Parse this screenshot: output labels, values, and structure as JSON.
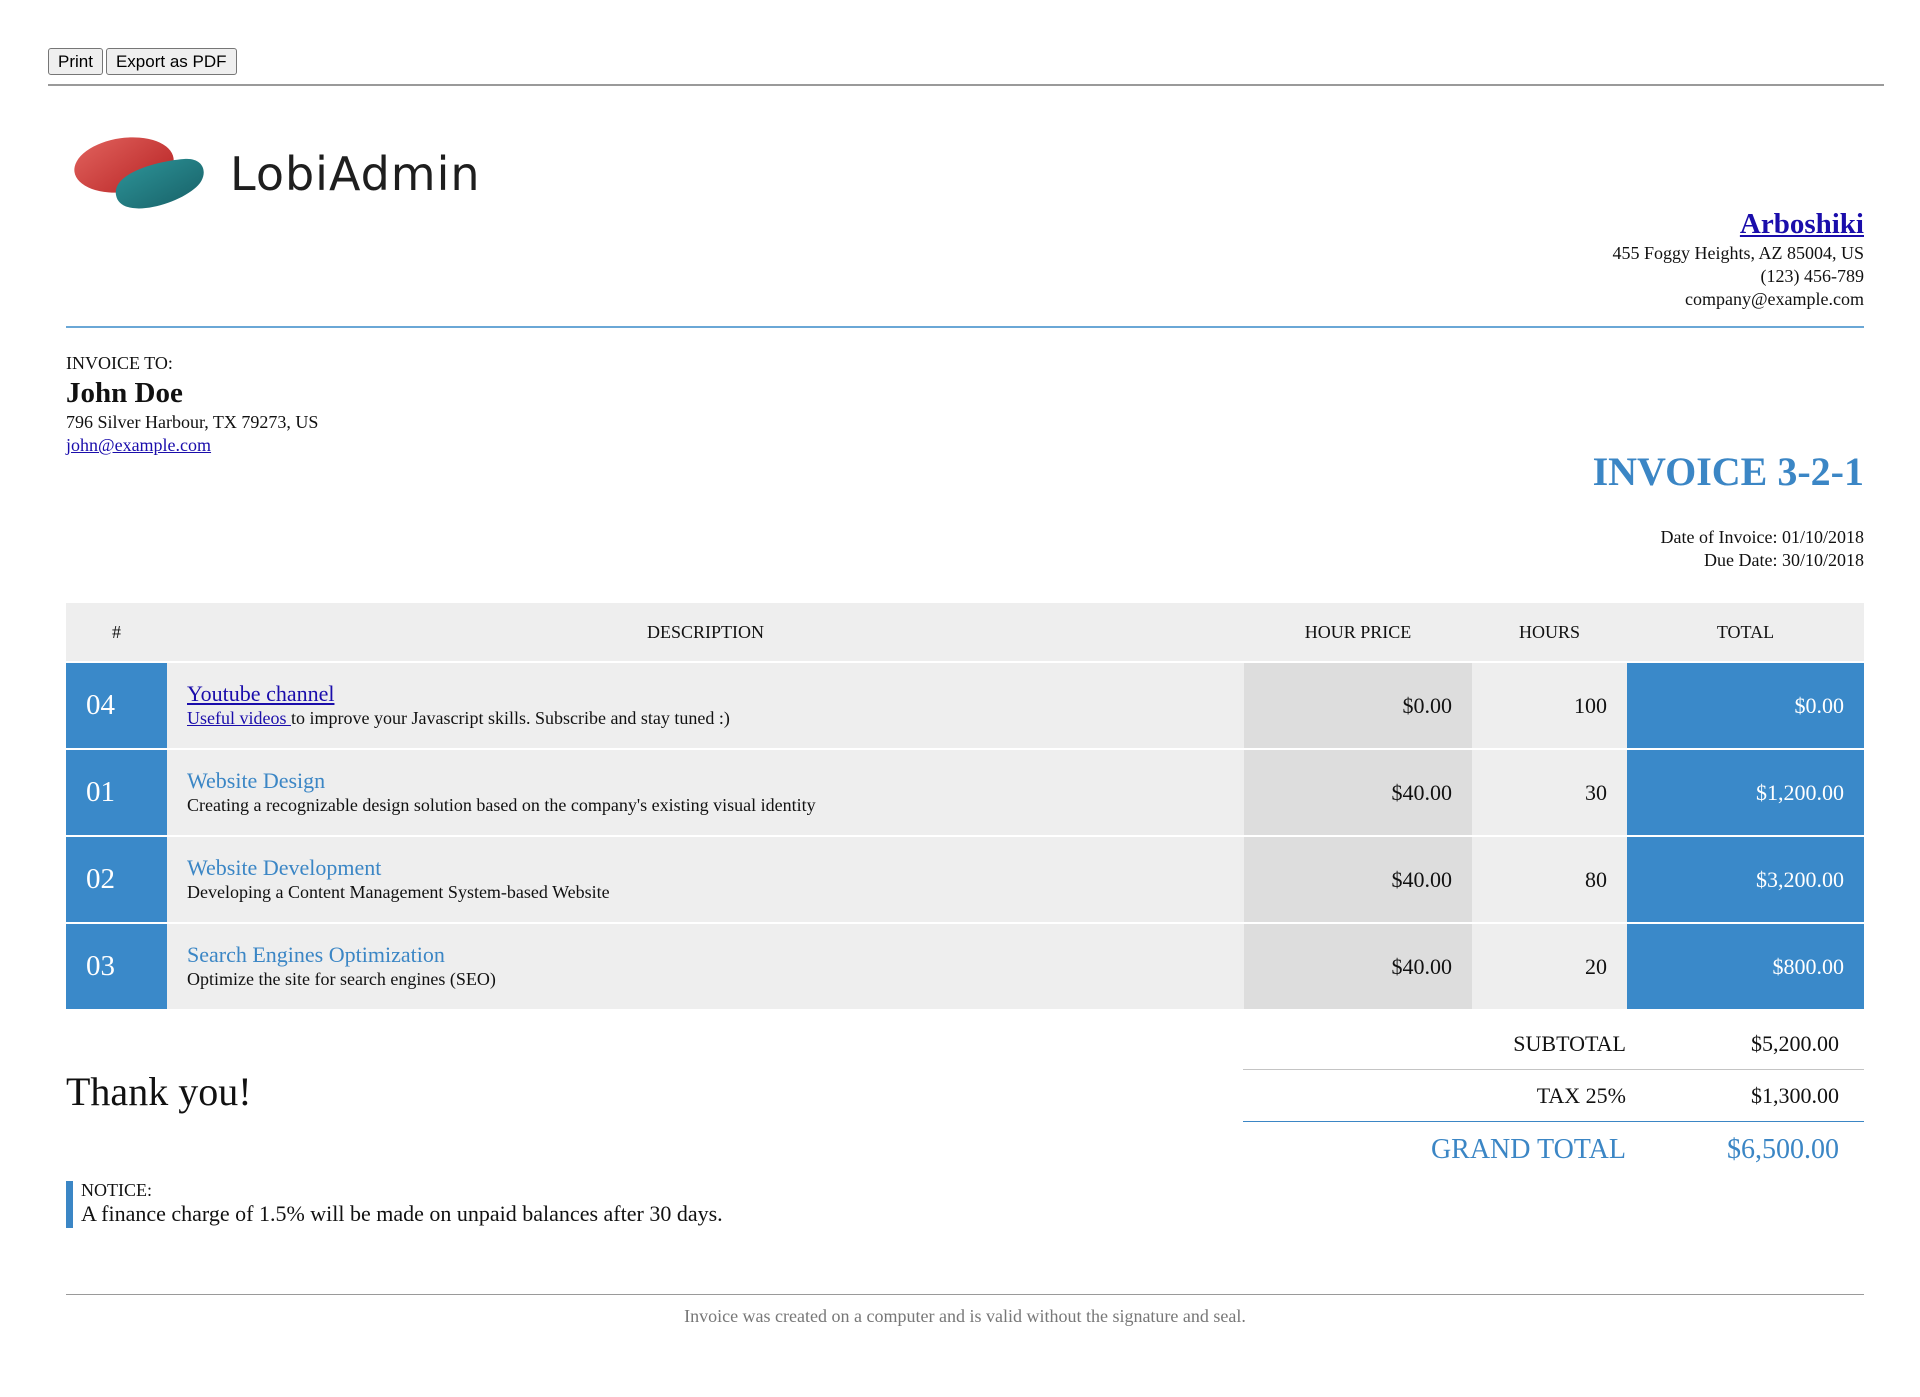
{
  "toolbar": {
    "print_label": "Print",
    "export_label": "Export as PDF"
  },
  "brand": {
    "name": "LobiAdmin",
    "accent_color": "#3b86c5",
    "logo_colors": [
      "#d23d3b",
      "#1f7a80"
    ]
  },
  "company": {
    "name": "Arboshiki",
    "address": "455 Foggy Heights, AZ 85004, US",
    "phone": "(123) 456-789",
    "email": "company@example.com"
  },
  "client": {
    "label": "INVOICE TO:",
    "name": "John Doe",
    "address": "796 Silver Harbour, TX 79273, US",
    "email": "john@example.com"
  },
  "invoice": {
    "title": "INVOICE 3-2-1",
    "date_of_invoice": "Date of Invoice: 01/10/2018",
    "due_date": "Due Date: 30/10/2018"
  },
  "table": {
    "headers": [
      "#",
      "DESCRIPTION",
      "HOUR PRICE",
      "HOURS",
      "TOTAL"
    ],
    "rows": [
      {
        "no": "04",
        "title": "Youtube channel",
        "desc_link": "Useful videos ",
        "desc": "to improve your Javascript skills. Subscribe and stay tuned :)",
        "price": "$0.00",
        "hours": "100",
        "total": "$0.00"
      },
      {
        "no": "01",
        "title": "Website Design",
        "desc": "Creating a recognizable design solution based on the company's existing visual identity",
        "price": "$40.00",
        "hours": "30",
        "total": "$1,200.00"
      },
      {
        "no": "02",
        "title": "Website Development",
        "desc": "Developing a Content Management System-based Website",
        "price": "$40.00",
        "hours": "80",
        "total": "$3,200.00"
      },
      {
        "no": "03",
        "title": "Search Engines Optimization",
        "desc": "Optimize the site for search engines (SEO)",
        "price": "$40.00",
        "hours": "20",
        "total": "$800.00"
      }
    ]
  },
  "totals": {
    "subtotal_label": "SUBTOTAL",
    "subtotal_value": "$5,200.00",
    "tax_label": "TAX 25%",
    "tax_value": "$1,300.00",
    "grand_label": "GRAND TOTAL",
    "grand_value": "$6,500.00"
  },
  "thanks": "Thank you!",
  "notice": {
    "label": "NOTICE:",
    "text": "A finance charge of 1.5% will be made on unpaid balances after 30 days."
  },
  "footer": "Invoice was created on a computer and is valid without the signature and seal."
}
